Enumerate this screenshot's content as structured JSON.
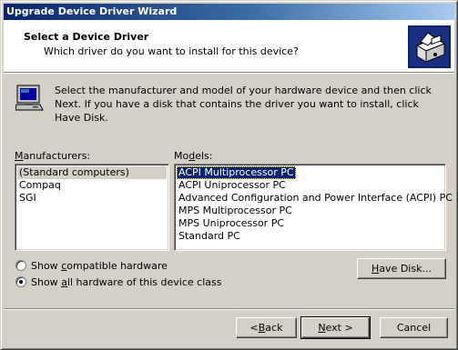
{
  "window": {
    "title": "Upgrade Device Driver Wizard"
  },
  "header": {
    "title": "Select a Device Driver",
    "subtitle": "Which driver do you want to install for this device?",
    "icon": "hardware-install-icon"
  },
  "instructions": {
    "icon": "computer-icon",
    "text": "Select the manufacturer and model of your hardware device and then click Next. If you have a disk that contains the driver you want to install, click Have Disk."
  },
  "manufacturers": {
    "label_prefix": "M",
    "label_rest": "anufacturers:",
    "items": [
      "(Standard computers)",
      "Compaq",
      "SGI"
    ],
    "selected_index": 0
  },
  "models": {
    "label_prefix": "Mo",
    "label_accel": "d",
    "label_rest": "els:",
    "items": [
      "ACPI Multiprocessor PC",
      "ACPI Uniprocessor PC",
      "Advanced Configuration and Power Interface (ACPI) PC",
      "MPS Multiprocessor PC",
      "MPS Uniprocessor PC",
      "Standard PC"
    ],
    "selected_index": 0
  },
  "options": {
    "compatible": {
      "pre": "Show ",
      "accel": "c",
      "post": "ompatible hardware",
      "checked": false
    },
    "all": {
      "pre": "Show ",
      "accel": "a",
      "post": "ll hardware of this device class",
      "checked": true
    }
  },
  "buttons": {
    "have_disk": {
      "accel": "H",
      "rest": "ave Disk..."
    },
    "back": {
      "pre": "< ",
      "accel": "B",
      "rest": "ack"
    },
    "next": {
      "accel": "N",
      "rest": "ext >"
    },
    "cancel": "Cancel"
  },
  "colors": {
    "title_bar": "#0a246a",
    "selection": "#0a246a",
    "face": "#d4d0c8"
  }
}
